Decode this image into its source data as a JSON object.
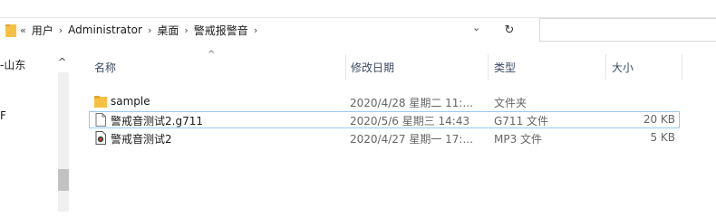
{
  "address": {
    "back_glyph": "«",
    "crumbs": [
      "用户",
      "Administrator",
      "桌面",
      "警戒报警音"
    ],
    "separator": "›",
    "dropdown_glyph": "⌄",
    "refresh_glyph": "↻"
  },
  "nav": {
    "label": "-山东",
    "up_glyph": "^",
    "fragment": "F"
  },
  "columns": {
    "name": "名称",
    "date": "修改日期",
    "type": "类型",
    "size": "大小",
    "sort_glyph": "^"
  },
  "files": [
    {
      "name": "sample",
      "date": "2020/4/28 星期二 11:...",
      "type": "文件夹",
      "size": "",
      "icon": "folder-icon"
    },
    {
      "name": "警戒音测试2.g711",
      "date": "2020/5/6 星期三 14:43",
      "type": "G711 文件",
      "size": "20 KB",
      "icon": "blank-file-icon"
    },
    {
      "name": "警戒音测试2",
      "date": "2020/4/27 星期一 17:...",
      "type": "MP3 文件",
      "size": "5 KB",
      "icon": "audio-file-icon"
    }
  ],
  "colors": {
    "folder": "#f6c143",
    "selection_border": "#99c9ef",
    "header_text": "#3b4a63"
  }
}
